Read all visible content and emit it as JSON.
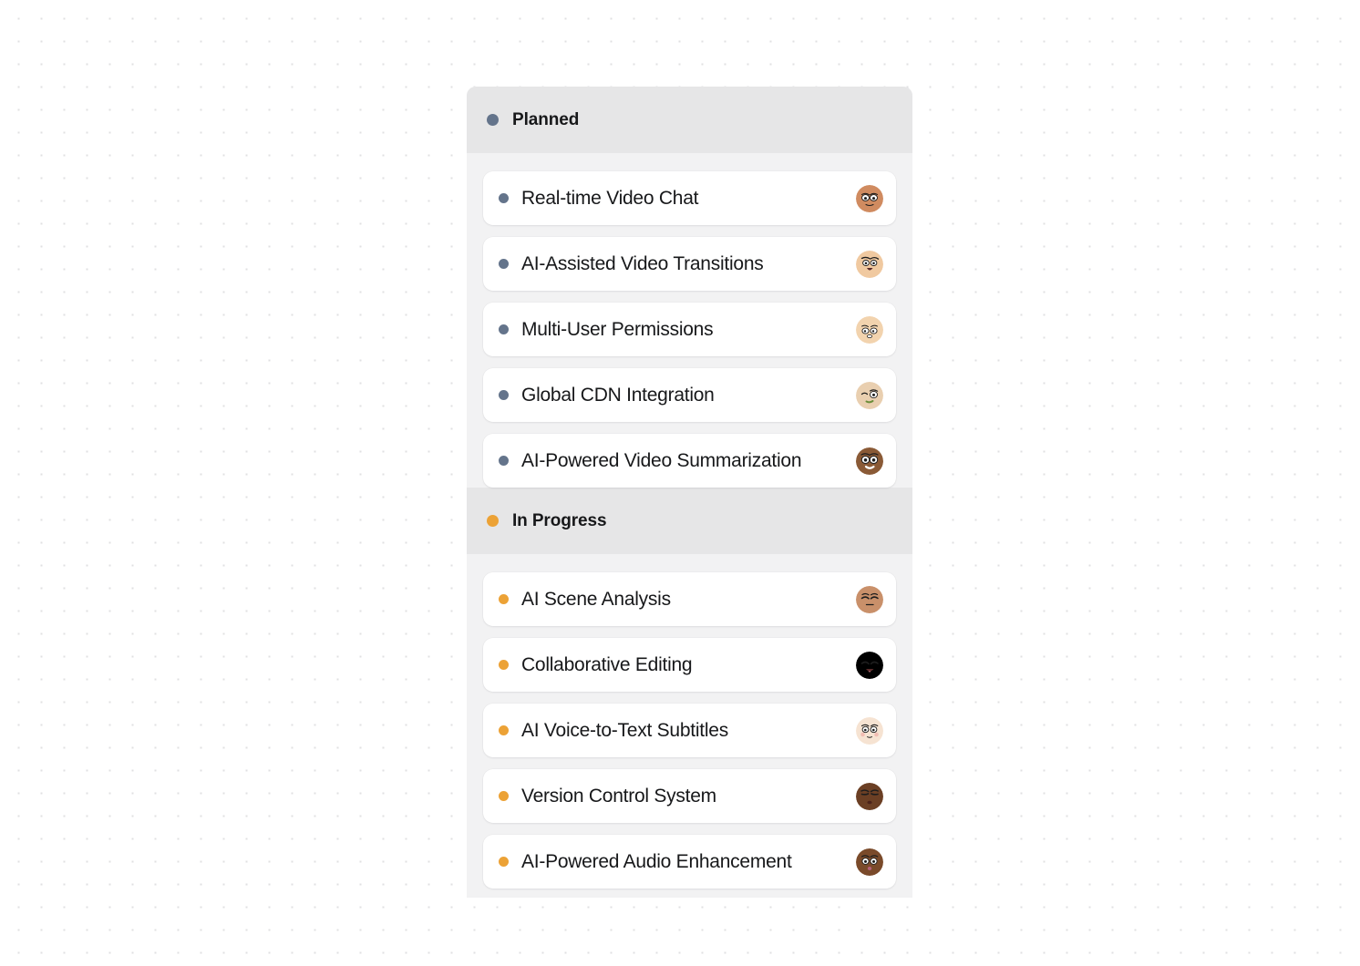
{
  "board": {
    "columns": [
      {
        "id": "planned",
        "title": "Planned",
        "dot_color": "#64748b",
        "cards": [
          {
            "title": "Real-time Video Chat",
            "avatar": {
              "bg": "#d08b60",
              "face": "sleepy-face",
              "skin": "#e8b089"
            }
          },
          {
            "title": "AI-Assisted Video Transitions",
            "avatar": {
              "bg": "#f0c9a0",
              "face": "tongue-out-face",
              "skin": "#f3d3ad"
            }
          },
          {
            "title": "Multi-User Permissions",
            "avatar": {
              "bg": "#f2d3ae",
              "face": "dizzy-face",
              "skin": "#f4d7b4"
            }
          },
          {
            "title": "Global CDN Integration",
            "avatar": {
              "bg": "#e9cfb0",
              "face": "wink-smirk-face",
              "skin": "#ecd3b5"
            }
          },
          {
            "title": "AI-Powered Video Summarization",
            "avatar": {
              "bg": "#8a5a36",
              "face": "wide-eyes-face",
              "skin": "#95633c"
            }
          }
        ]
      },
      {
        "id": "in-progress",
        "title": "In Progress",
        "dot_color": "#eca236",
        "cards": [
          {
            "title": "AI Scene Analysis",
            "avatar": {
              "bg": "#c9906a",
              "face": "closed-eyes-face",
              "skin": "#d69a72"
            }
          },
          {
            "title": "Collaborative Editing",
            "avatar": {
              "bg": "#f0ce ab",
              "face": "happy-tongue-face",
              "skin": "#f2d2b0"
            }
          },
          {
            "title": "AI Voice-to-Text Subtitles",
            "avatar": {
              "bg": "#f6e3d2",
              "face": "blush-face",
              "skin": "#f7e6d7"
            }
          },
          {
            "title": "Version Control System",
            "avatar": {
              "bg": "#6b3f24",
              "face": "angry-face",
              "skin": "#74462a"
            }
          },
          {
            "title": "AI-Powered Audio Enhancement",
            "avatar": {
              "bg": "#7a4a2a",
              "face": "surprised-face",
              "skin": "#84512f"
            }
          }
        ]
      }
    ]
  }
}
